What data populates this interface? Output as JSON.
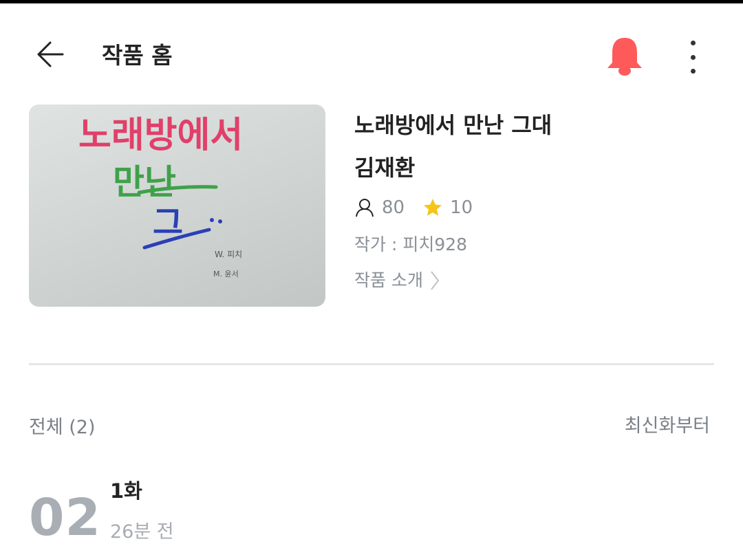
{
  "header": {
    "title": "작품 홈",
    "bell_color": "#ff5a5a"
  },
  "cover": {
    "line1": "노래방에서",
    "line2": "만난",
    "line3": "그",
    "writer_sign": "W. 피치",
    "art_sign": "M. 윤서",
    "colors": {
      "line1": "#e0406a",
      "line2": "#3fa14a",
      "line3": "#2b3fb5"
    }
  },
  "work": {
    "title": "노래방에서 만난 그대",
    "author": "김재환",
    "views": "80",
    "rating": "10",
    "writer": "작가 : 피치928",
    "intro_label": "작품 소개"
  },
  "list": {
    "count_label": "전체 (2)",
    "sort_label": "최신화부터"
  },
  "episodes": [
    {
      "number": "02",
      "title": "1화",
      "time": "26분 전"
    }
  ],
  "icons": {
    "back": "arrow-left-icon",
    "bell": "bell-icon",
    "more": "more-vertical-icon",
    "person": "person-icon",
    "star": "star-icon",
    "chevron": "chevron-right-icon"
  }
}
